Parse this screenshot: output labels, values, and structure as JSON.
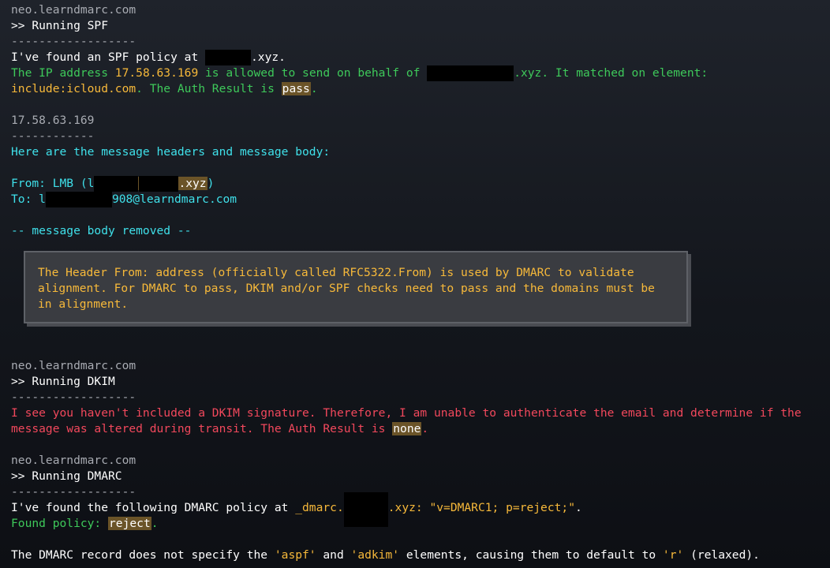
{
  "spf": {
    "host": "neo.learndmarc.com",
    "title": ">> Running SPF",
    "sep": "------------------",
    "found_prefix": "I've found an SPF policy at ",
    "found_suffix": ".xyz.",
    "ip_prefix": "The IP address ",
    "ip": "17.58.63.169",
    "ip_mid": " is allowed to send on behalf of ",
    "ip_suffix": ".xyz. It matched on element:",
    "include": "include:icloud.com",
    "auth_prefix": ". The Auth Result is ",
    "result": "pass",
    "auth_suffix": "."
  },
  "headers": {
    "ip": "17.58.63.169",
    "sep": "------------",
    "intro": "Here are the message headers and message body:",
    "from_prefix": "From: LMB (",
    "from_char": "l",
    "from_domain": ".xyz",
    "from_suffix": ")",
    "to_prefix": "To: l",
    "to_suffix": "908@learndmarc.com",
    "body_removed": "-- message body removed --"
  },
  "info_box": {
    "text": "The Header From: address (officially called RFC5322.From) is used by DMARC to validate alignment. For DMARC to pass, DKIM and/or SPF checks need to pass and the domains must be in alignment."
  },
  "dkim": {
    "host": "neo.learndmarc.com",
    "title": ">> Running DKIM",
    "sep": "------------------",
    "line1": "I see you haven't included a DKIM signature. Therefore, I am unable to authenticate the email and determine if the",
    "line2_prefix": "message was altered during transit. The Auth Result is ",
    "result": "none",
    "line2_suffix": "."
  },
  "dmarc": {
    "host": "neo.learndmarc.com",
    "title": ">> Running DMARC",
    "sep": "------------------",
    "found_prefix": "I've found the following DMARC policy at ",
    "found_domain": "_dmarc.",
    "found_mid": ".xyz: ",
    "record": "\"v=DMARC1; p=reject;\"",
    "found_suffix": ".",
    "policy_prefix": "Found policy: ",
    "policy": "reject",
    "policy_suffix": ".",
    "note_prefix": "The DMARC record does not specify the ",
    "aspf": "'aspf'",
    "and": " and ",
    "adkim": "'adkim'",
    "note_mid": " elements, causing them to default to ",
    "r": "'r'",
    "note_suffix": " (relaxed)."
  }
}
